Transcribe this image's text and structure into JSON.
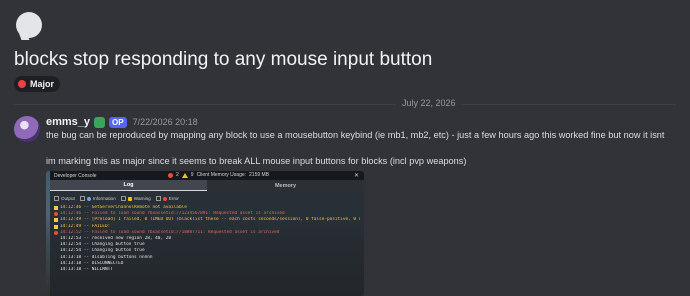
{
  "post": {
    "title": "blocks stop responding to any mouse input button",
    "tag": {
      "label": "Major",
      "color": "#f23f43"
    },
    "date_divider": "July 22, 2026"
  },
  "message": {
    "username": "emms_y",
    "op_label": "OP",
    "timestamp": "7/22/2026 20:18",
    "lines": [
      "the bug can be reproduced by mapping any block to use a mousebutton keybind (ie mb1, mb2, etc) - just a few hours ago this worked fine but now it isnt",
      "im marking this as major since it seems to break ALL mouse input buttons for blocks (incl pvp weapons)"
    ]
  },
  "console": {
    "title": "Developer Console",
    "error_count": "2",
    "warning_count": "9",
    "memory_label": "Client Memory Usage:",
    "memory_value": "2159 MB",
    "close": "✕",
    "tabs": [
      {
        "label": "Log",
        "active": true
      },
      {
        "label": "Memory",
        "active": false
      }
    ],
    "filters": [
      "Output",
      "Information",
      "Warning",
      "Error"
    ],
    "log": [
      {
        "level": "warning",
        "text": "14:12:46 -- GetServerChannelRemote not available"
      },
      {
        "level": "error",
        "text": "14:12:46 -- Failed to load sound rbxassetid://1234567891: Requested asset is archived"
      },
      {
        "level": "warning",
        "text": "14:12:49 -- [Preload] 1 failed, 0 TIMED OUT (blacklist these -- each costs seconds/session), 0 false-positive, 0 unresolved"
      },
      {
        "level": "warning",
        "text": "14:12:49 --     FAILED:"
      },
      {
        "level": "error",
        "text": "14:12:52 -- Failed to load sound rbxassetid://18887711: Requested asset is archived"
      },
      {
        "level": "output",
        "text": "14:12:53 -- received new region 28, 40, 28"
      },
      {
        "level": "output",
        "text": "14:12:54 -- Changing button true"
      },
      {
        "level": "output",
        "text": "14:12:54 -- Changing button true"
      },
      {
        "level": "output",
        "text": "14:13:18 -- disabling buttons nnnnn"
      },
      {
        "level": "output",
        "text": "14:13:18 -- DISCONNECTED"
      },
      {
        "level": "output",
        "text": "14:13:18 -- NILLNNTT"
      }
    ]
  }
}
